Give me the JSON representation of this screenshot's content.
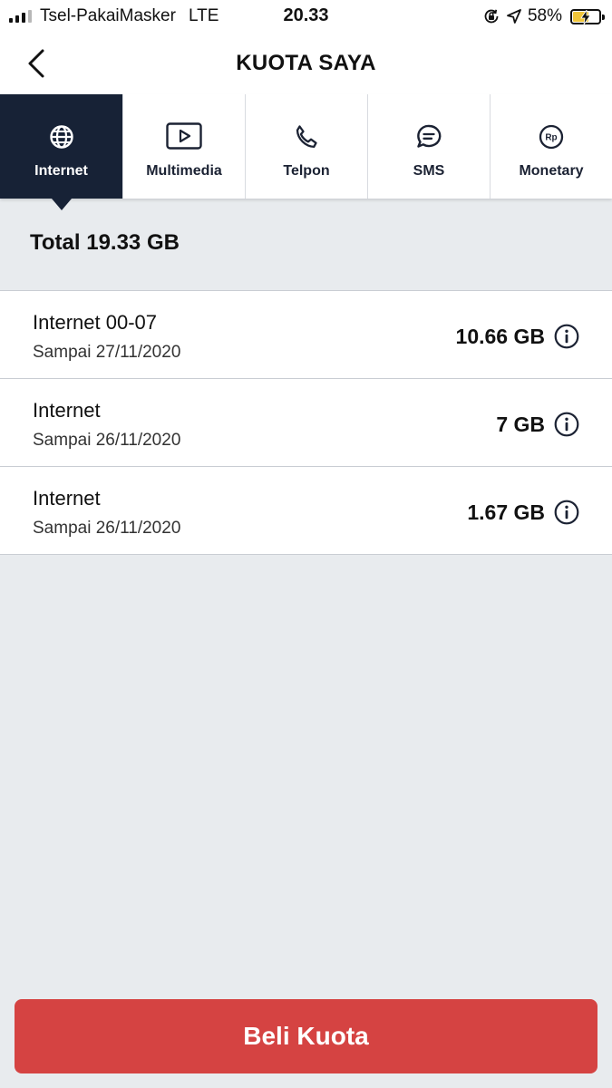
{
  "status_bar": {
    "carrier": "Tsel-PakaiMasker",
    "network": "LTE",
    "time": "20.33",
    "battery": "58%",
    "battery_level": 0.58
  },
  "header": {
    "title": "KUOTA SAYA",
    "back_icon": "chevron-left-icon"
  },
  "tabs": [
    {
      "label": "Internet",
      "icon": "globe-icon",
      "active": true
    },
    {
      "label": "Multimedia",
      "icon": "play-icon",
      "active": false
    },
    {
      "label": "Telpon",
      "icon": "phone-icon",
      "active": false
    },
    {
      "label": "SMS",
      "icon": "chat-bubble-icon",
      "active": false
    },
    {
      "label": "Monetary",
      "icon": "rupiah-coin-icon",
      "active": false
    }
  ],
  "total": "Total 19.33 GB",
  "quota_items": [
    {
      "name": "Internet 00-07",
      "expiry": "Sampai 27/11/2020",
      "amount": "10.66 GB"
    },
    {
      "name": "Internet",
      "expiry": "Sampai 26/11/2020",
      "amount": "7 GB"
    },
    {
      "name": "Internet",
      "expiry": "Sampai 26/11/2020",
      "amount": "1.67 GB"
    }
  ],
  "buy_button": "Beli Kuota",
  "colors": {
    "active_tab": "#172236",
    "button": "#d54342",
    "background": "#e8ebee",
    "battery": "#f1c63a"
  }
}
